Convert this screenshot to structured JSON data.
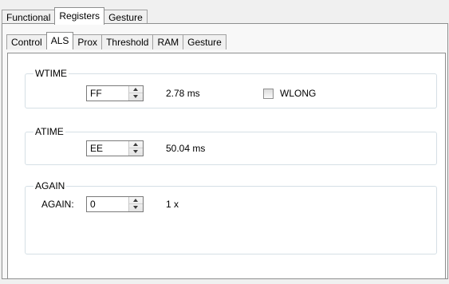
{
  "outer_tabs": [
    "Functional",
    "Registers",
    "Gesture"
  ],
  "outer_active": "Registers",
  "inner_tabs": [
    "Control",
    "ALS",
    "Prox",
    "Threshold",
    "RAM",
    "Gesture"
  ],
  "inner_active": "ALS",
  "wtime": {
    "title": "WTIME",
    "value": "FF",
    "result": "2.78 ms",
    "checkbox_label": "WLONG",
    "checkbox_checked": false
  },
  "atime": {
    "title": "ATIME",
    "value": "EE",
    "result": "50.04 ms"
  },
  "again": {
    "title": "AGAIN",
    "field_label": "AGAIN:",
    "value": "0",
    "result": "1 x"
  },
  "icons": {
    "spin_up": "arrow-up-icon",
    "spin_down": "arrow-down-icon"
  },
  "colors": {
    "panel": "#ffffff",
    "chrome": "#f0f0f0",
    "border": "#8e8f8f"
  }
}
